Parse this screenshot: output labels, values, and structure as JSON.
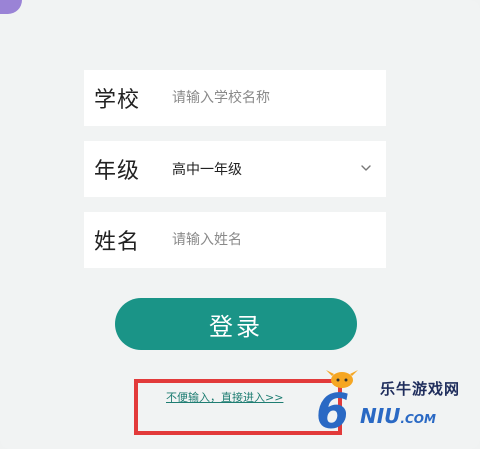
{
  "form": {
    "school": {
      "label": "学校",
      "placeholder": "请输入学校名称",
      "value": ""
    },
    "grade": {
      "label": "年级",
      "selected": "高中一年级"
    },
    "name": {
      "label": "姓名",
      "placeholder": "请输入姓名",
      "value": ""
    },
    "login_label": "登录",
    "direct_entry_label": "不便输入，直接进入>>"
  },
  "watermark": {
    "digit": "6",
    "cn_text": "乐牛游戏网",
    "en_text": "NIU",
    "domain_suffix": ".COM"
  },
  "colors": {
    "accent": "#1a9487",
    "highlight": "#e23a3a",
    "corner": "#9a83d6"
  }
}
